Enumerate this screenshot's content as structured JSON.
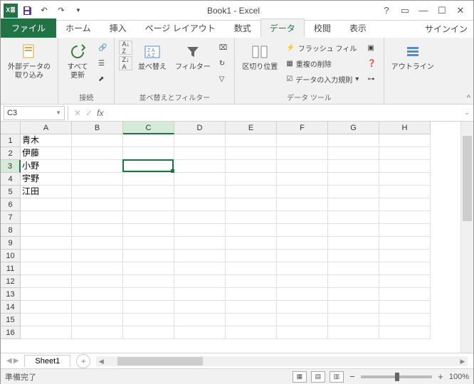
{
  "title": "Book1 - Excel",
  "signin": "サインイン",
  "tabs": {
    "file": "ファイル",
    "home": "ホーム",
    "insert": "挿入",
    "pagelayout": "ページ レイアウト",
    "formulas": "数式",
    "data": "データ",
    "review": "校閲",
    "view": "表示"
  },
  "ribbon": {
    "ext_data": "外部データの\n取り込み",
    "refresh": "すべて\n更新",
    "conn_group": "接続",
    "sort_asc": "A→Z",
    "sort_desc": "Z→A",
    "sort": "並べ替え",
    "filter": "フィルター",
    "sort_filter_group": "並べ替えとフィルター",
    "text_to_col": "区切り位置",
    "flash_fill": "フラッシュ フィル",
    "remove_dup": "重複の削除",
    "data_valid": "データの入力規則",
    "tools_group": "データ ツール",
    "outline": "アウトライン"
  },
  "namebox": "C3",
  "columns": [
    "A",
    "B",
    "C",
    "D",
    "E",
    "F",
    "G",
    "H"
  ],
  "sel_col_idx": 2,
  "sel_row_idx": 2,
  "rows": 16,
  "cell_data": {
    "A1": "青木",
    "A2": "伊藤",
    "A3": "小野",
    "A4": "宇野",
    "A5": "江田"
  },
  "sheet": "Sheet1",
  "status": "準備完了",
  "zoom": "100%"
}
